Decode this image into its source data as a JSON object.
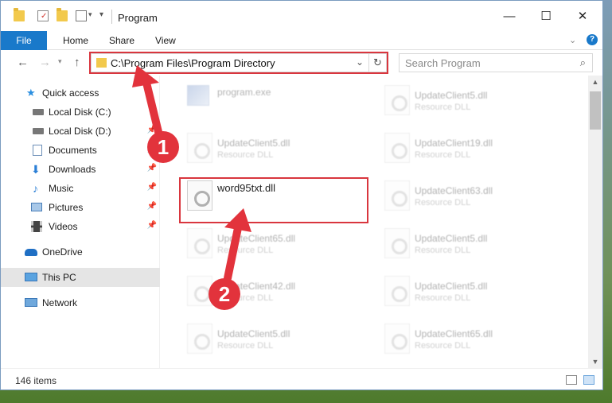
{
  "window": {
    "title": "Program",
    "controls": {
      "minimize": "—",
      "maximize": "☐",
      "close": "✕"
    }
  },
  "ribbon": {
    "tabs": [
      "File",
      "Home",
      "Share",
      "View"
    ],
    "help": "?"
  },
  "address": {
    "path": "C:\\Program Files\\Program Directory",
    "search_placeholder": "Search Program"
  },
  "sidebar": {
    "items": [
      {
        "label": "Quick access",
        "icon": "star-icon",
        "pinned": false
      },
      {
        "label": "Local Disk (C:)",
        "icon": "drive-c-icon",
        "pinned": true
      },
      {
        "label": "Local Disk (D:)",
        "icon": "drive-d-icon",
        "pinned": true
      },
      {
        "label": "Documents",
        "icon": "documents-icon",
        "pinned": true
      },
      {
        "label": "Downloads",
        "icon": "downloads-icon",
        "pinned": true
      },
      {
        "label": "Music",
        "icon": "music-icon",
        "pinned": true
      },
      {
        "label": "Pictures",
        "icon": "pictures-icon",
        "pinned": true
      },
      {
        "label": "Videos",
        "icon": "videos-icon",
        "pinned": true
      },
      {
        "label": "OneDrive",
        "icon": "cloud-icon",
        "pinned": false
      },
      {
        "label": "This PC",
        "icon": "computer-icon",
        "pinned": false,
        "selected": true
      },
      {
        "label": "Network",
        "icon": "network-icon",
        "pinned": false
      }
    ]
  },
  "files": {
    "left_column": [
      {
        "name": "program.exe",
        "type": ""
      },
      {
        "name": "UpdateClient5.dll",
        "type": "Resource DLL"
      },
      {
        "name": "word95txt.dll",
        "type": ""
      },
      {
        "name": "UpdateClient65.dll",
        "type": "Resource DLL"
      },
      {
        "name": "UpdateClient42.dll",
        "type": "Resource DLL"
      },
      {
        "name": "UpdateClient5.dll",
        "type": "Resource DLL"
      }
    ],
    "right_column": [
      {
        "name": "UpdateClient5.dll",
        "type": "Resource DLL"
      },
      {
        "name": "UpdateClient19.dll",
        "type": "Resource DLL"
      },
      {
        "name": "UpdateClient63.dll",
        "type": "Resource DLL"
      },
      {
        "name": "UpdateClient5.dll",
        "type": "Resource DLL"
      },
      {
        "name": "UpdateClient5.dll",
        "type": "Resource DLL"
      },
      {
        "name": "UpdateClient65.dll",
        "type": "Resource DLL"
      }
    ]
  },
  "status": {
    "item_count": "146 items"
  },
  "annotations": {
    "step1": "1",
    "step2": "2",
    "color": "#e2333c"
  }
}
